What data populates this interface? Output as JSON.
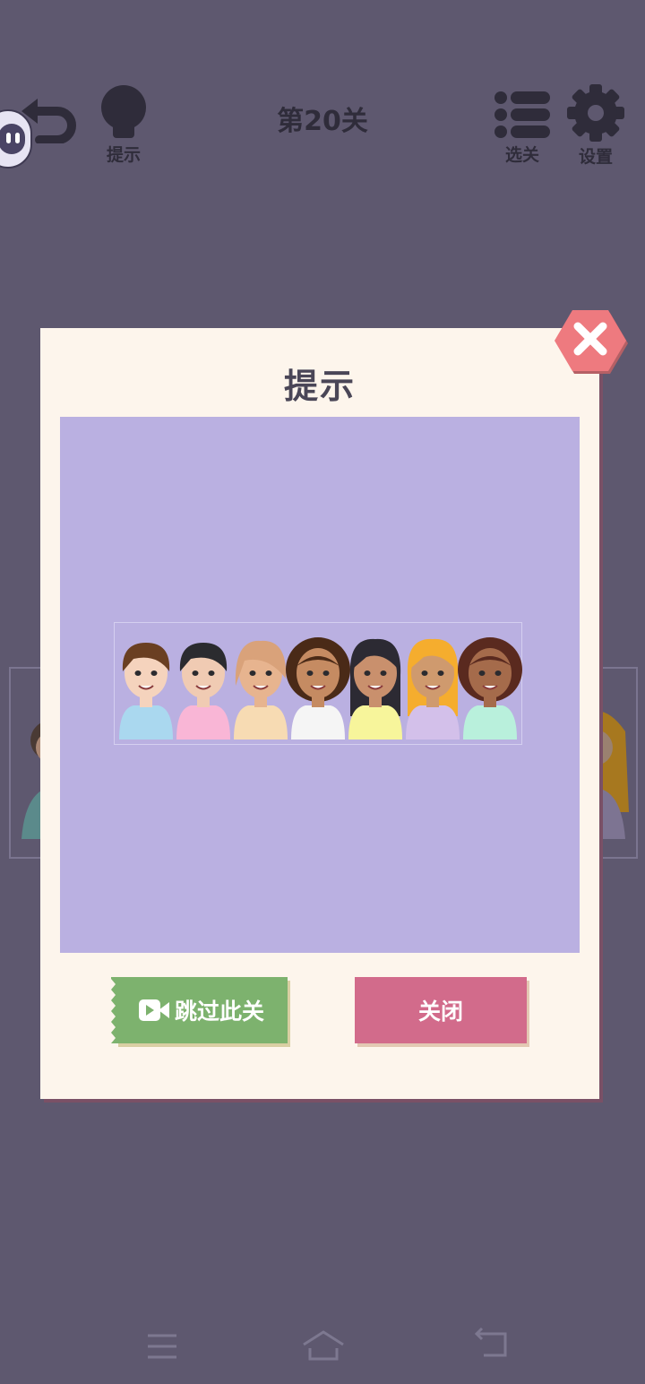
{
  "header": {
    "level_title": "第20关",
    "hint_label": "提示",
    "select_label": "选关",
    "settings_label": "设置"
  },
  "dialog": {
    "title": "提示",
    "skip_label": "跳过此关",
    "close_label": "关闭"
  },
  "hint_image": {
    "people_count": 7
  },
  "colors": {
    "background": "#5e586f",
    "dialog_bg": "#fdf5ec",
    "hint_area": "#bab0e1",
    "skip_button": "#7db26e",
    "close_button": "#d26b8b",
    "close_icon": "#ee7a7f"
  },
  "icons": [
    "back-icon",
    "lightbulb-icon",
    "list-icon",
    "gear-icon",
    "close-icon",
    "video-icon",
    "menu-icon",
    "home-icon",
    "return-icon"
  ]
}
